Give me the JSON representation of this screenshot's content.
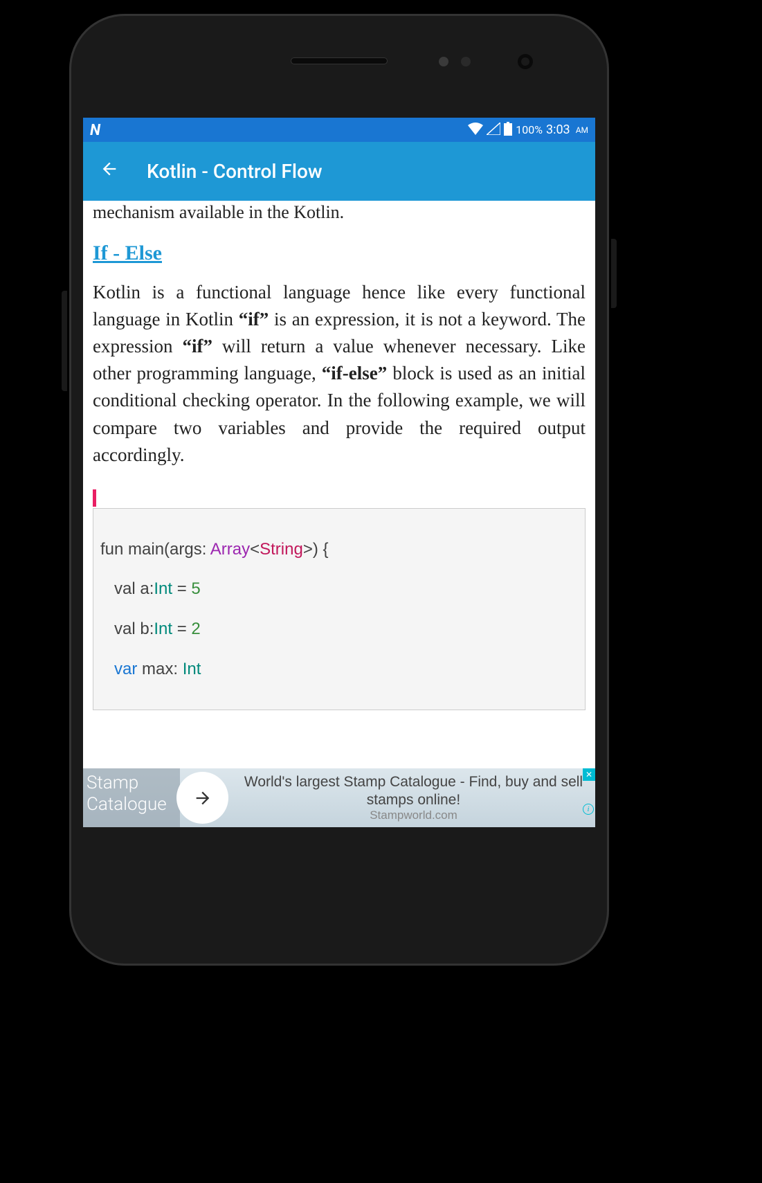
{
  "statusBar": {
    "batteryPercent": "100%",
    "time": "3:03",
    "ampm": "AM"
  },
  "appBar": {
    "title": "Kotlin - Control Flow"
  },
  "content": {
    "introFragment": "mechanism available in the Kotlin.",
    "sectionHeading": "If - Else",
    "para1_part1": "Kotlin is a functional language hence like every functional language in Kotlin ",
    "para1_bold1": "“if”",
    "para1_part2": " is an expression, it is not a keyword. The expression ",
    "para1_bold2": "“if”",
    "para1_part3": " will return a value whenever necessary. Like other programming language, ",
    "para1_bold3": "“if-else”",
    "para1_part4": " block is used as an initial conditional checking operator. In the following example, we will compare two variables and provide the required output accordingly."
  },
  "code": {
    "line1_p1": "fun main(args: ",
    "line1_p2": "Array",
    "line1_p3": "<",
    "line1_p4": "String",
    "line1_p5": ">) {",
    "line2_p1": "val a:",
    "line2_p2": "Int",
    "line2_p3": " = ",
    "line2_p4": "5",
    "line3_p1": "val b:",
    "line3_p2": "Int",
    "line3_p3": " = ",
    "line3_p4": "2",
    "line4_p1": "var",
    "line4_p2": " max: ",
    "line4_p3": "Int"
  },
  "ad": {
    "leftLine1": "Stamp",
    "leftLine2": "Catalogue",
    "headline": "World's largest Stamp Catalogue - Find, buy and sell stamps online!",
    "url": "Stampworld.com"
  }
}
